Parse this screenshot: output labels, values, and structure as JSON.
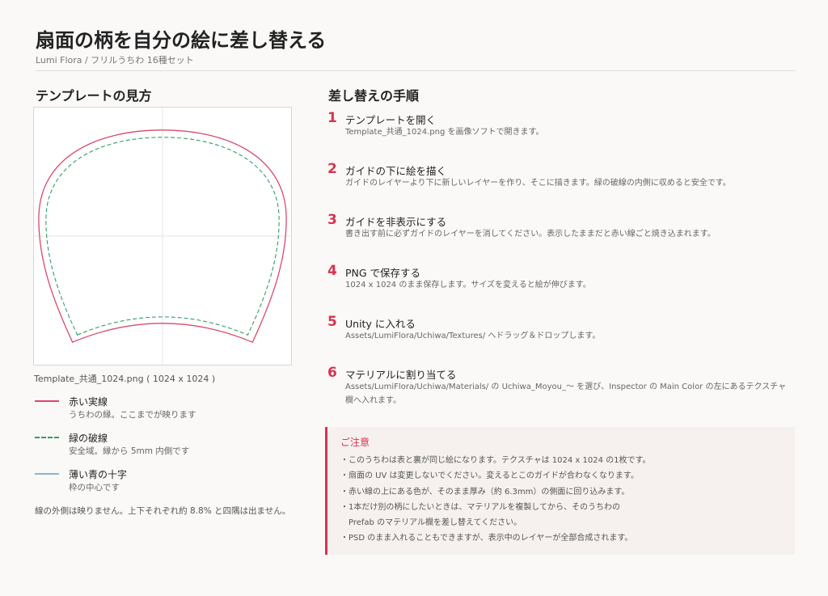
{
  "header": {
    "title": "扇面の柄を自分の絵に差し替える",
    "subtitle": "Lumi Flora / フリルうちわ 16種セット"
  },
  "left": {
    "heading": "テンプレートの見方",
    "caption": "Template_共通_1024.png ( 1024 x 1024 )",
    "legend": [
      {
        "title": "赤い実線",
        "desc": "うちわの縁。ここまでが映ります"
      },
      {
        "title": "緑の破線",
        "desc": "安全域。縁から 5mm 内側です"
      },
      {
        "title": "薄い青の十字",
        "desc": "枠の中心です"
      }
    ],
    "note": "線の外側は映りません。上下それぞれ約 8.8% と四隅は出ません。"
  },
  "right": {
    "heading": "差し替えの手順",
    "steps": [
      {
        "num": "1",
        "title": "テンプレートを開く",
        "desc": "Template_共通_1024.png を画像ソフトで開きます。"
      },
      {
        "num": "2",
        "title": "ガイドの下に絵を描く",
        "desc": "ガイドのレイヤーより下に新しいレイヤーを作り、そこに描きます。緑の破線の内側に収めると安全です。"
      },
      {
        "num": "3",
        "title": "ガイドを非表示にする",
        "desc": "書き出す前に必ずガイドのレイヤーを消してください。表示したままだと赤い線ごと焼き込まれます。"
      },
      {
        "num": "4",
        "title": "PNG で保存する",
        "desc": "1024 x 1024 のまま保存します。サイズを変えると絵が伸びます。"
      },
      {
        "num": "5",
        "title": "Unity に入れる",
        "desc": "Assets/LumiFlora/Uchiwa/Textures/ へドラッグ＆ドロップします。"
      },
      {
        "num": "6",
        "title": "マテリアルに割り当てる",
        "desc": "Assets/LumiFlora/Uchiwa/Materials/ の Uchiwa_Moyou_～ を選び、Inspector の Main Color の左にあるテクスチャ欄へ入れます。"
      }
    ]
  },
  "notice": {
    "title": "ご注意",
    "items": [
      "・このうちわは表と裏が同じ絵になります。テクスチャは 1024 x 1024 の1枚です。",
      "・扇面の UV は変更しないでください。変えるとこのガイドが合わなくなります。",
      "・赤い線の上にある色が、そのまま厚み（約 6.3mm）の側面に回り込みます。",
      "・1本だけ別の柄にしたいときは、マテリアルを複製してから、そのうちわの",
      "　Prefab のマテリアル欄を差し替えてください。",
      "・PSD のまま入れることもできますが、表示中のレイヤーが全部合成されます。"
    ]
  },
  "colors": {
    "accent": "#d6334f",
    "edge_red": "#d9486a",
    "safe_green": "#2f9e63",
    "center_blue": "#8fb3cf"
  }
}
